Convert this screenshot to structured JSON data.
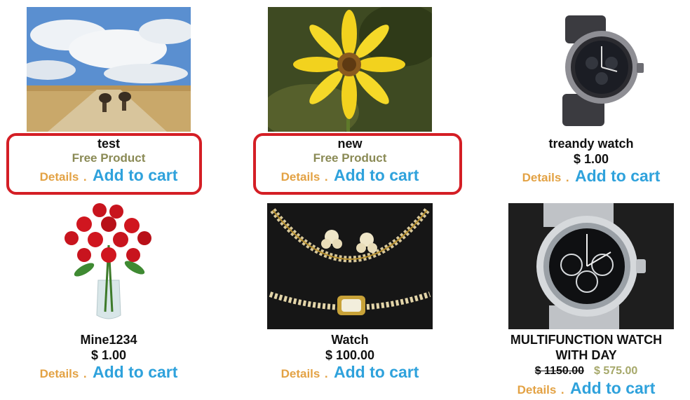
{
  "products": [
    {
      "name": "test",
      "price_text": "Free Product",
      "details_label": "Details",
      "separator": ".",
      "cart_label": "Add to cart"
    },
    {
      "name": "new",
      "price_text": "Free Product",
      "details_label": "Details",
      "separator": ".",
      "cart_label": "Add to cart"
    },
    {
      "name": "treandy watch",
      "price_text": "$ 1.00",
      "details_label": "Details",
      "separator": ".",
      "cart_label": "Add to cart"
    },
    {
      "name": "Mine1234",
      "price_text": "$ 1.00",
      "details_label": "Details",
      "separator": ".",
      "cart_label": "Add to cart"
    },
    {
      "name": "Watch",
      "price_text": "$ 100.00",
      "details_label": "Details",
      "separator": ".",
      "cart_label": "Add to cart"
    },
    {
      "name_line1": "MULTIFUNCTION WATCH",
      "name_line2": "WITH DAY",
      "old_price": "$ 1150.00",
      "sale_price": "$ 575.00",
      "details_label": "Details",
      "separator": ".",
      "cart_label": "Add to cart"
    }
  ],
  "colors": {
    "details": "#e3a244",
    "add_to_cart": "#2fa2dc",
    "free_product": "#8a8a55",
    "highlight_border": "#d41e25"
  },
  "icons": [
    "road-ostriches-image",
    "yellow-flower-image",
    "wrist-watch-image",
    "rose-bouquet-image",
    "pearl-necklace-image",
    "chronograph-watch-image"
  ]
}
